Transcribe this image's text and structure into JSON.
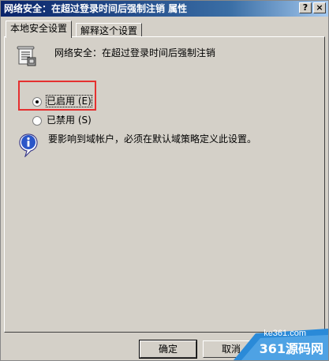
{
  "window": {
    "title": "网络安全：在超过登录时间后强制注销 属性",
    "help_button": "?",
    "close_button": "×"
  },
  "tabs": [
    {
      "label": "本地安全设置",
      "active": true
    },
    {
      "label": "解释这个设置",
      "active": false
    }
  ],
  "policy": {
    "icon": "policy-scroll-icon",
    "name": "网络安全：在超过登录时间后强制注销"
  },
  "options": [
    {
      "label": "已启用",
      "hotkey": "(E)",
      "checked": true
    },
    {
      "label": "已禁用",
      "hotkey": "(S)",
      "checked": false
    }
  ],
  "info": {
    "icon": "info-icon",
    "text": "要影响到域帐户，必须在默认域策略定义此设置。"
  },
  "buttons": {
    "ok": "确定",
    "cancel": "取消"
  },
  "watermark": {
    "url": "ke361.com",
    "brand": "361源码网"
  },
  "colors": {
    "titlebar_start": "#0a246a",
    "dialog_bg": "#d4d0c8",
    "highlight": "#e53030"
  }
}
